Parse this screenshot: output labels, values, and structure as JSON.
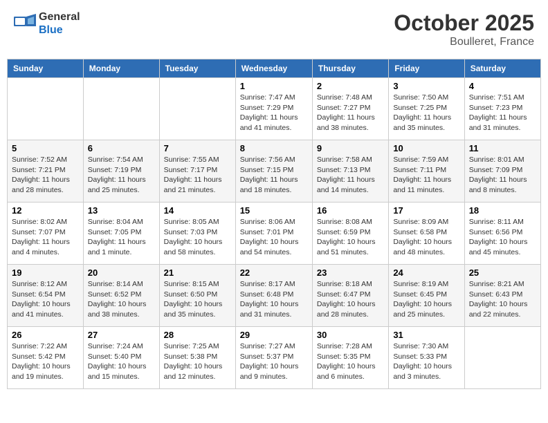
{
  "header": {
    "logo_general": "General",
    "logo_blue": "Blue",
    "month": "October 2025",
    "location": "Boulleret, France"
  },
  "weekdays": [
    "Sunday",
    "Monday",
    "Tuesday",
    "Wednesday",
    "Thursday",
    "Friday",
    "Saturday"
  ],
  "weeks": [
    [
      {
        "day": "",
        "info": ""
      },
      {
        "day": "",
        "info": ""
      },
      {
        "day": "",
        "info": ""
      },
      {
        "day": "1",
        "info": "Sunrise: 7:47 AM\nSunset: 7:29 PM\nDaylight: 11 hours and 41 minutes."
      },
      {
        "day": "2",
        "info": "Sunrise: 7:48 AM\nSunset: 7:27 PM\nDaylight: 11 hours and 38 minutes."
      },
      {
        "day": "3",
        "info": "Sunrise: 7:50 AM\nSunset: 7:25 PM\nDaylight: 11 hours and 35 minutes."
      },
      {
        "day": "4",
        "info": "Sunrise: 7:51 AM\nSunset: 7:23 PM\nDaylight: 11 hours and 31 minutes."
      }
    ],
    [
      {
        "day": "5",
        "info": "Sunrise: 7:52 AM\nSunset: 7:21 PM\nDaylight: 11 hours and 28 minutes."
      },
      {
        "day": "6",
        "info": "Sunrise: 7:54 AM\nSunset: 7:19 PM\nDaylight: 11 hours and 25 minutes."
      },
      {
        "day": "7",
        "info": "Sunrise: 7:55 AM\nSunset: 7:17 PM\nDaylight: 11 hours and 21 minutes."
      },
      {
        "day": "8",
        "info": "Sunrise: 7:56 AM\nSunset: 7:15 PM\nDaylight: 11 hours and 18 minutes."
      },
      {
        "day": "9",
        "info": "Sunrise: 7:58 AM\nSunset: 7:13 PM\nDaylight: 11 hours and 14 minutes."
      },
      {
        "day": "10",
        "info": "Sunrise: 7:59 AM\nSunset: 7:11 PM\nDaylight: 11 hours and 11 minutes."
      },
      {
        "day": "11",
        "info": "Sunrise: 8:01 AM\nSunset: 7:09 PM\nDaylight: 11 hours and 8 minutes."
      }
    ],
    [
      {
        "day": "12",
        "info": "Sunrise: 8:02 AM\nSunset: 7:07 PM\nDaylight: 11 hours and 4 minutes."
      },
      {
        "day": "13",
        "info": "Sunrise: 8:04 AM\nSunset: 7:05 PM\nDaylight: 11 hours and 1 minute."
      },
      {
        "day": "14",
        "info": "Sunrise: 8:05 AM\nSunset: 7:03 PM\nDaylight: 10 hours and 58 minutes."
      },
      {
        "day": "15",
        "info": "Sunrise: 8:06 AM\nSunset: 7:01 PM\nDaylight: 10 hours and 54 minutes."
      },
      {
        "day": "16",
        "info": "Sunrise: 8:08 AM\nSunset: 6:59 PM\nDaylight: 10 hours and 51 minutes."
      },
      {
        "day": "17",
        "info": "Sunrise: 8:09 AM\nSunset: 6:58 PM\nDaylight: 10 hours and 48 minutes."
      },
      {
        "day": "18",
        "info": "Sunrise: 8:11 AM\nSunset: 6:56 PM\nDaylight: 10 hours and 45 minutes."
      }
    ],
    [
      {
        "day": "19",
        "info": "Sunrise: 8:12 AM\nSunset: 6:54 PM\nDaylight: 10 hours and 41 minutes."
      },
      {
        "day": "20",
        "info": "Sunrise: 8:14 AM\nSunset: 6:52 PM\nDaylight: 10 hours and 38 minutes."
      },
      {
        "day": "21",
        "info": "Sunrise: 8:15 AM\nSunset: 6:50 PM\nDaylight: 10 hours and 35 minutes."
      },
      {
        "day": "22",
        "info": "Sunrise: 8:17 AM\nSunset: 6:48 PM\nDaylight: 10 hours and 31 minutes."
      },
      {
        "day": "23",
        "info": "Sunrise: 8:18 AM\nSunset: 6:47 PM\nDaylight: 10 hours and 28 minutes."
      },
      {
        "day": "24",
        "info": "Sunrise: 8:19 AM\nSunset: 6:45 PM\nDaylight: 10 hours and 25 minutes."
      },
      {
        "day": "25",
        "info": "Sunrise: 8:21 AM\nSunset: 6:43 PM\nDaylight: 10 hours and 22 minutes."
      }
    ],
    [
      {
        "day": "26",
        "info": "Sunrise: 7:22 AM\nSunset: 5:42 PM\nDaylight: 10 hours and 19 minutes."
      },
      {
        "day": "27",
        "info": "Sunrise: 7:24 AM\nSunset: 5:40 PM\nDaylight: 10 hours and 15 minutes."
      },
      {
        "day": "28",
        "info": "Sunrise: 7:25 AM\nSunset: 5:38 PM\nDaylight: 10 hours and 12 minutes."
      },
      {
        "day": "29",
        "info": "Sunrise: 7:27 AM\nSunset: 5:37 PM\nDaylight: 10 hours and 9 minutes."
      },
      {
        "day": "30",
        "info": "Sunrise: 7:28 AM\nSunset: 5:35 PM\nDaylight: 10 hours and 6 minutes."
      },
      {
        "day": "31",
        "info": "Sunrise: 7:30 AM\nSunset: 5:33 PM\nDaylight: 10 hours and 3 minutes."
      },
      {
        "day": "",
        "info": ""
      }
    ]
  ]
}
